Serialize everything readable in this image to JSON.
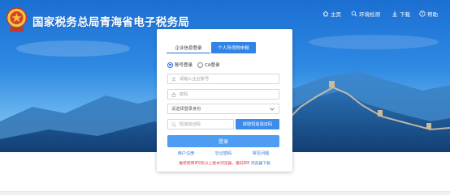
{
  "header": {
    "title": "国家税务总局青海省电子税务局",
    "emblem_text": "中国税务"
  },
  "nav": {
    "home": "主页",
    "env_check": "环境检测",
    "download": "下载",
    "help": "帮助"
  },
  "login": {
    "tabs": [
      "企业信息登录",
      "个人所得税申报"
    ],
    "radio_options": [
      "账号登录",
      "CA登录"
    ],
    "account_placeholder": "请输入企业账号",
    "password_placeholder": "密码",
    "identity_select": "请选择登录身份",
    "sms_placeholder": "短信验证码",
    "sms_button": "获取短信验证码",
    "login_button": "登录",
    "links": [
      "用户注册",
      "忘记密码",
      "常见问题"
    ],
    "notice_text": "推荐使用IE9及以上版本浏览器，最低IE8",
    "notice_link": "浏览器下载"
  },
  "colors": {
    "brand_blue": "#1e6fd8",
    "button_blue": "#3b8ced",
    "notice_red": "#e23c3c"
  }
}
